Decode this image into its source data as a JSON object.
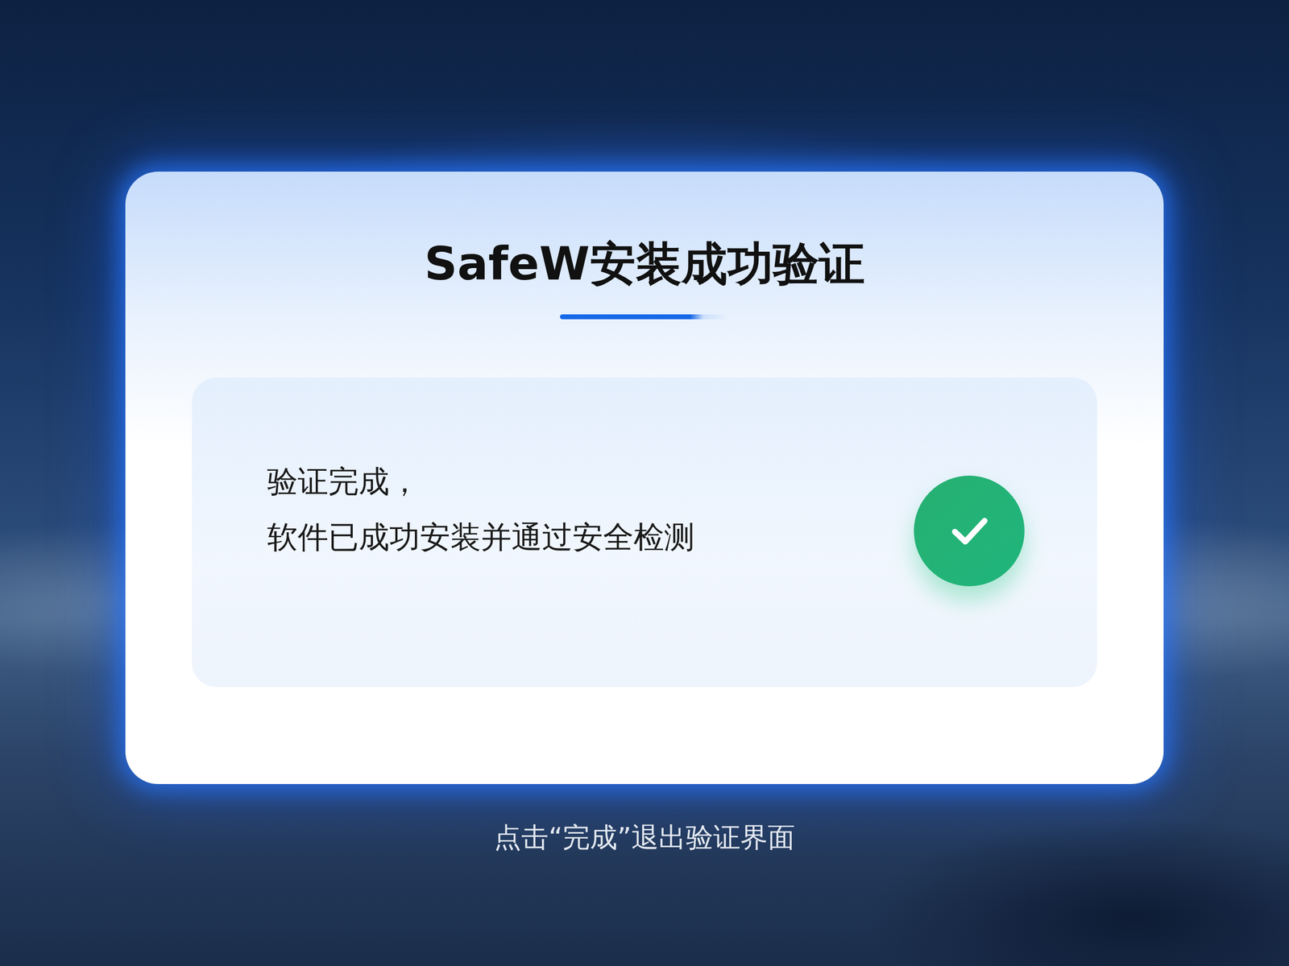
{
  "dialog": {
    "title": "SafeW安装成功验证",
    "message_lines": [
      "验证完成，",
      "软件已成功安装并通过安全检测"
    ],
    "status": {
      "verified": true
    }
  },
  "hint": "点击“完成”退出验证界面"
}
